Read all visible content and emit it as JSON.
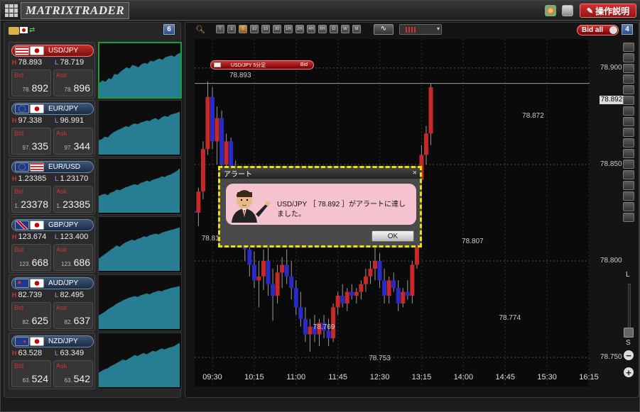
{
  "app": {
    "logo_text": "MATRIXTRADER",
    "help_button": "操作説明"
  },
  "left_panel": {
    "count_badge": "6",
    "pairs": [
      {
        "name": "USD/JPY",
        "flags": [
          "us",
          "jp"
        ],
        "high": "78.893",
        "low": "78.719",
        "bid_prefix": "78.",
        "bid_big": "892",
        "ask_prefix": "78.",
        "ask_big": "896",
        "selected": true,
        "spark": [
          0.2,
          0.25,
          0.22,
          0.3,
          0.28,
          0.4,
          0.38,
          0.45,
          0.5,
          0.55,
          0.52,
          0.6,
          0.58,
          0.55,
          0.62,
          0.65,
          0.63,
          0.7,
          0.68,
          0.72,
          0.75,
          0.72,
          0.78,
          0.8,
          0.82,
          0.79,
          0.85,
          0.88
        ]
      },
      {
        "name": "EUR/JPY",
        "flags": [
          "eu",
          "jp"
        ],
        "high": "97.338",
        "low": "96.991",
        "bid_prefix": "97.",
        "bid_big": "335",
        "ask_prefix": "97.",
        "ask_big": "344",
        "selected": false,
        "spark": [
          0.2,
          0.22,
          0.28,
          0.26,
          0.33,
          0.38,
          0.42,
          0.45,
          0.48,
          0.52,
          0.5,
          0.55,
          0.58,
          0.56,
          0.6,
          0.62,
          0.65,
          0.63,
          0.68,
          0.7,
          0.66,
          0.72,
          0.75,
          0.73,
          0.78,
          0.8,
          0.82,
          0.85
        ]
      },
      {
        "name": "EUR/USD",
        "flags": [
          "eu",
          "us"
        ],
        "high": "1.23385",
        "low": "1.23170",
        "bid_prefix": "1.",
        "bid_big": "23378",
        "ask_prefix": "1.",
        "ask_big": "23385",
        "selected": false,
        "spark": [
          0.25,
          0.28,
          0.3,
          0.27,
          0.33,
          0.35,
          0.4,
          0.38,
          0.42,
          0.45,
          0.47,
          0.5,
          0.52,
          0.5,
          0.55,
          0.57,
          0.6,
          0.58,
          0.62,
          0.64,
          0.66,
          0.7,
          0.68,
          0.72,
          0.74,
          0.78,
          0.82,
          0.88
        ]
      },
      {
        "name": "GBP/JPY",
        "flags": [
          "gb",
          "jp"
        ],
        "high": "123.674",
        "low": "123.400",
        "bid_prefix": "123.",
        "bid_big": "668",
        "ask_prefix": "123.",
        "ask_big": "686",
        "selected": false,
        "spark": [
          0.15,
          0.2,
          0.25,
          0.3,
          0.35,
          0.4,
          0.45,
          0.42,
          0.48,
          0.52,
          0.55,
          0.58,
          0.56,
          0.6,
          0.62,
          0.66,
          0.64,
          0.68,
          0.7,
          0.72,
          0.7,
          0.74,
          0.76,
          0.78,
          0.8,
          0.82,
          0.84,
          0.86
        ]
      },
      {
        "name": "AUD/JPY",
        "flags": [
          "au",
          "jp"
        ],
        "high": "82.739",
        "low": "82.495",
        "bid_prefix": "82.",
        "bid_big": "625",
        "ask_prefix": "82.",
        "ask_big": "637",
        "selected": false,
        "spark": [
          0.18,
          0.22,
          0.26,
          0.32,
          0.36,
          0.4,
          0.45,
          0.48,
          0.52,
          0.55,
          0.58,
          0.6,
          0.62,
          0.6,
          0.64,
          0.66,
          0.68,
          0.66,
          0.7,
          0.72,
          0.74,
          0.73,
          0.76,
          0.78,
          0.8,
          0.82,
          0.83,
          0.85
        ]
      },
      {
        "name": "NZD/JPY",
        "flags": [
          "nz",
          "jp"
        ],
        "high": "63.528",
        "low": "63.349",
        "bid_prefix": "63.",
        "bid_big": "524",
        "ask_prefix": "63.",
        "ask_big": "542",
        "selected": false,
        "spark": [
          0.2,
          0.24,
          0.28,
          0.3,
          0.35,
          0.38,
          0.42,
          0.46,
          0.5,
          0.48,
          0.52,
          0.56,
          0.6,
          0.58,
          0.62,
          0.65,
          0.62,
          0.66,
          0.7,
          0.68,
          0.72,
          0.75,
          0.73,
          0.76,
          0.78,
          0.8,
          0.84,
          0.88
        ]
      }
    ]
  },
  "chart_panel": {
    "count_badge": "4",
    "bid_all": "Bid all",
    "timeframes": [
      "T",
      "1",
      "5",
      "10",
      "15",
      "30",
      "1H",
      "2H",
      "4H",
      "8H",
      "D",
      "W",
      "M"
    ],
    "active_timeframe": "5",
    "tag_label": "USD/JPY 5分足",
    "tag_side": "Bid",
    "current_price": "78.892",
    "scale_labels": [
      "L",
      "S"
    ],
    "annotations": [
      {
        "text": "78.893",
        "t": "10:00",
        "v": 78.893
      },
      {
        "text": "78.815",
        "t": "09:30",
        "v": 78.815
      },
      {
        "text": "78.769",
        "t": "11:30",
        "v": 78.769
      },
      {
        "text": "78.753",
        "t": "12:30",
        "v": 78.753
      },
      {
        "text": "78.807",
        "t": "14:10",
        "v": 78.807
      },
      {
        "text": "78.774",
        "t": "14:50",
        "v": 78.774
      },
      {
        "text": "78.872",
        "t": "15:15",
        "v": 78.872
      }
    ]
  },
  "chart_data": {
    "type": "candlestick",
    "title": "USD/JPY 5分足",
    "x": [
      "09:30",
      "10:15",
      "11:00",
      "11:45",
      "12:30",
      "13:15",
      "14:00",
      "14:45",
      "15:30",
      "16:15"
    ],
    "y_ticks": [
      "78.900",
      "78.850",
      "78.800",
      "78.750"
    ],
    "ylim": [
      78.735,
      78.915
    ],
    "grid": true,
    "candles": [
      [
        78.835,
        78.845,
        78.815,
        78.82
      ],
      [
        78.82,
        78.83,
        78.812,
        78.826
      ],
      [
        78.826,
        78.84,
        78.82,
        78.825
      ],
      [
        78.825,
        78.838,
        78.818,
        78.836
      ],
      [
        78.836,
        78.862,
        78.832,
        78.858
      ],
      [
        78.858,
        78.893,
        78.855,
        78.885
      ],
      [
        78.885,
        78.89,
        78.858,
        78.862
      ],
      [
        78.862,
        78.88,
        78.85,
        78.874
      ],
      [
        78.874,
        78.878,
        78.845,
        78.85
      ],
      [
        78.85,
        78.866,
        78.848,
        78.862
      ],
      [
        78.862,
        78.864,
        78.842,
        78.846
      ],
      [
        78.846,
        78.852,
        78.83,
        78.835
      ],
      [
        78.835,
        78.84,
        78.815,
        78.82
      ],
      [
        78.82,
        78.824,
        78.8,
        78.806
      ],
      [
        78.806,
        78.812,
        78.792,
        78.798
      ],
      [
        78.798,
        78.805,
        78.786,
        78.79
      ],
      [
        78.79,
        78.8,
        78.776,
        78.792
      ],
      [
        78.792,
        78.806,
        78.785,
        78.8
      ],
      [
        78.8,
        78.808,
        78.782,
        78.788
      ],
      [
        78.788,
        78.796,
        78.769,
        78.782
      ],
      [
        78.782,
        78.798,
        78.778,
        78.794
      ],
      [
        78.794,
        78.802,
        78.786,
        78.798
      ],
      [
        78.798,
        78.806,
        78.788,
        78.792
      ],
      [
        78.792,
        78.8,
        78.78,
        78.786
      ],
      [
        78.786,
        78.79,
        78.772,
        78.776
      ],
      [
        78.776,
        78.784,
        78.766,
        78.77
      ],
      [
        78.77,
        78.776,
        78.758,
        78.762
      ],
      [
        78.762,
        78.77,
        78.753,
        78.766
      ],
      [
        78.766,
        78.772,
        78.758,
        78.762
      ],
      [
        78.762,
        78.77,
        78.756,
        78.768
      ],
      [
        78.768,
        78.772,
        78.76,
        78.764
      ],
      [
        78.764,
        78.77,
        78.756,
        78.76
      ],
      [
        78.76,
        78.778,
        78.758,
        78.776
      ],
      [
        78.776,
        78.784,
        78.772,
        78.782
      ],
      [
        78.782,
        78.788,
        78.776,
        78.778
      ],
      [
        78.778,
        78.786,
        78.774,
        78.784
      ],
      [
        78.784,
        78.788,
        78.78,
        78.782
      ],
      [
        78.782,
        78.786,
        78.778,
        78.784
      ],
      [
        78.784,
        78.79,
        78.78,
        78.788
      ],
      [
        78.788,
        78.796,
        78.784,
        78.792
      ],
      [
        78.792,
        78.8,
        78.788,
        78.796
      ],
      [
        78.796,
        78.807,
        78.79,
        78.8
      ],
      [
        78.8,
        78.804,
        78.786,
        78.79
      ],
      [
        78.79,
        78.796,
        78.778,
        78.782
      ],
      [
        78.782,
        78.792,
        78.778,
        78.79
      ],
      [
        78.79,
        78.794,
        78.784,
        78.786
      ],
      [
        78.786,
        78.79,
        78.774,
        78.778
      ],
      [
        78.778,
        78.786,
        78.776,
        78.784
      ],
      [
        78.784,
        78.79,
        78.78,
        78.782
      ],
      [
        78.782,
        78.8,
        78.778,
        78.798
      ],
      [
        78.798,
        78.845,
        78.796,
        78.842
      ],
      [
        78.842,
        78.86,
        78.836,
        78.855
      ],
      [
        78.855,
        78.87,
        78.85,
        78.866
      ],
      [
        78.866,
        78.892,
        78.86,
        78.89
      ]
    ]
  }
}
